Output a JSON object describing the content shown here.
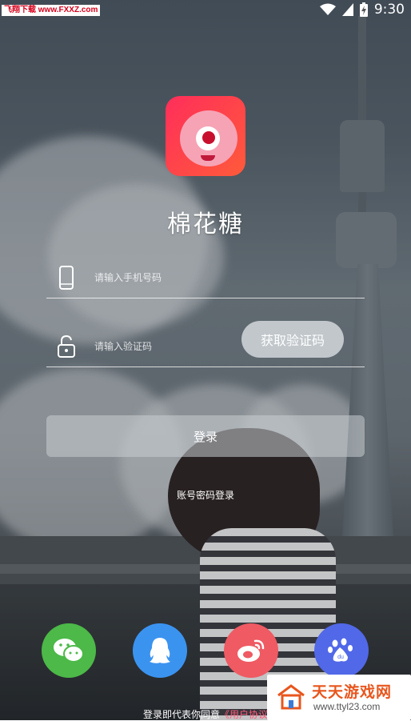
{
  "status_bar": {
    "watermark": "飞翔下载 www.FXXZ.com",
    "time": "9:30",
    "icons": [
      "wifi-icon",
      "signal-icon",
      "battery-charging-icon"
    ]
  },
  "app": {
    "name": "棉花糖",
    "logo_icon": "marshmallow-monster-logo"
  },
  "form": {
    "phone_placeholder": "请输入手机号码",
    "phone_icon": "phone-icon",
    "code_placeholder": "请输入验证码",
    "code_icon": "unlock-icon",
    "get_code_label": "获取验证码",
    "login_label": "登录",
    "alt_login_label": "账号密码登录"
  },
  "social": [
    {
      "name": "wechat",
      "icon": "wechat-icon",
      "color": "#4cb948"
    },
    {
      "name": "qq",
      "icon": "qq-icon",
      "color": "#3b93f0"
    },
    {
      "name": "weibo",
      "icon": "weibo-icon",
      "color": "#ef5a63"
    },
    {
      "name": "baidu",
      "icon": "baidu-icon",
      "color": "#5168e8"
    }
  ],
  "agreement": {
    "prefix": "登录即代表你同意",
    "link": "《用户协议"
  },
  "watermark": {
    "title": "天天游戏网",
    "url": "www.ttyl23.com"
  }
}
